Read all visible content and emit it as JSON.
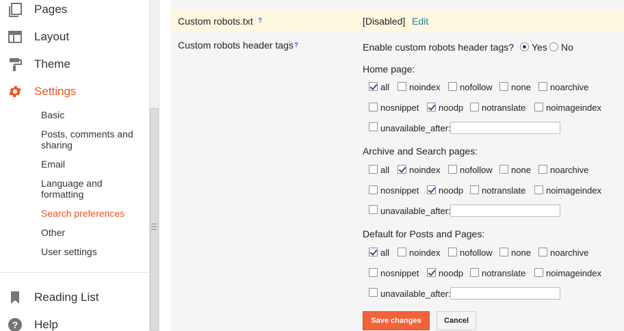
{
  "sidebar": {
    "nav": [
      {
        "label": "Pages",
        "icon": "pages-icon"
      },
      {
        "label": "Layout",
        "icon": "layout-icon"
      },
      {
        "label": "Theme",
        "icon": "theme-icon"
      },
      {
        "label": "Settings",
        "icon": "gear-icon",
        "active": true
      }
    ],
    "settings_sub": [
      {
        "label": "Basic"
      },
      {
        "label": "Posts, comments and sharing"
      },
      {
        "label": "Email"
      },
      {
        "label": "Language and formatting"
      },
      {
        "label": "Search preferences",
        "active": true
      },
      {
        "label": "Other"
      },
      {
        "label": "User settings"
      }
    ],
    "bottom_nav": [
      {
        "label": "Reading List",
        "icon": "bookmark-icon"
      },
      {
        "label": "Help",
        "icon": "help-icon"
      }
    ]
  },
  "robots_txt": {
    "label": "Custom robots.txt",
    "help": "?",
    "status": "[Disabled]",
    "edit_label": "Edit"
  },
  "robots_header": {
    "label": "Custom robots header tags",
    "help": "?",
    "enable_question": "Enable custom robots header tags?",
    "options": [
      {
        "label": "Yes",
        "selected": true
      },
      {
        "label": "No",
        "selected": false
      }
    ]
  },
  "sections": [
    {
      "title": "Home page:",
      "tags": [
        {
          "label": "all",
          "checked": true
        },
        {
          "label": "noindex",
          "checked": false
        },
        {
          "label": "nofollow",
          "checked": false
        },
        {
          "label": "none",
          "checked": false
        },
        {
          "label": "noarchive",
          "checked": false
        },
        {
          "label": "nosnippet",
          "checked": false
        },
        {
          "label": "noodp",
          "checked": true
        },
        {
          "label": "notranslate",
          "checked": false
        },
        {
          "label": "noimageindex",
          "checked": false
        },
        {
          "label": "unavailable_after:",
          "checked": false
        }
      ],
      "unavailable_value": ""
    },
    {
      "title": "Archive and Search pages:",
      "tags": [
        {
          "label": "all",
          "checked": false
        },
        {
          "label": "noindex",
          "checked": true
        },
        {
          "label": "nofollow",
          "checked": false
        },
        {
          "label": "none",
          "checked": false
        },
        {
          "label": "noarchive",
          "checked": false
        },
        {
          "label": "nosnippet",
          "checked": false
        },
        {
          "label": "noodp",
          "checked": true
        },
        {
          "label": "notranslate",
          "checked": false
        },
        {
          "label": "noimageindex",
          "checked": false
        },
        {
          "label": "unavailable_after:",
          "checked": false
        }
      ],
      "unavailable_value": ""
    },
    {
      "title": "Default for Posts and Pages:",
      "tags": [
        {
          "label": "all",
          "checked": true
        },
        {
          "label": "noindex",
          "checked": false
        },
        {
          "label": "nofollow",
          "checked": false
        },
        {
          "label": "none",
          "checked": false
        },
        {
          "label": "noarchive",
          "checked": false
        },
        {
          "label": "nosnippet",
          "checked": false
        },
        {
          "label": "noodp",
          "checked": true
        },
        {
          "label": "notranslate",
          "checked": false
        },
        {
          "label": "noimageindex",
          "checked": false
        },
        {
          "label": "unavailable_after:",
          "checked": false
        }
      ],
      "unavailable_value": ""
    }
  ],
  "actions": {
    "save_label": "Save changes",
    "cancel_label": "Cancel"
  },
  "colors": {
    "accent": "#f4511e",
    "link": "#2a7f9e",
    "highlight_row": "#fff8e1"
  }
}
